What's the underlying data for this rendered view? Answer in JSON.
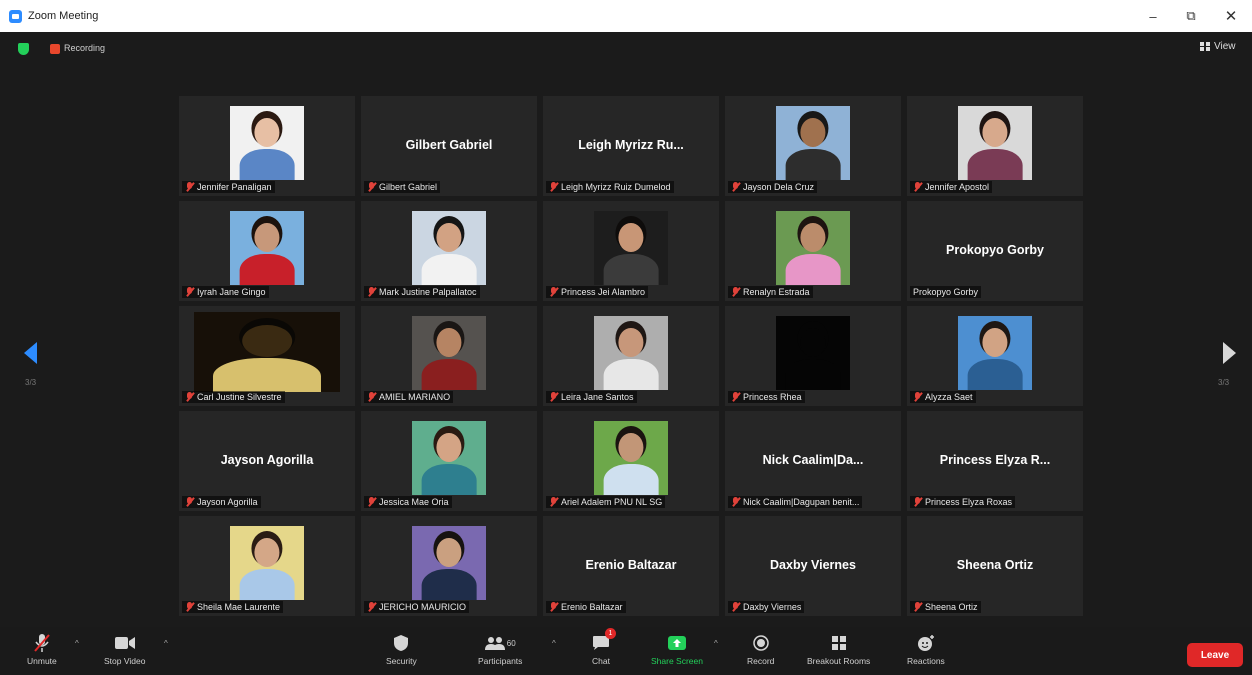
{
  "window": {
    "title": "Zoom Meeting",
    "minimize": "–",
    "maximize": "⧉",
    "close": "✕"
  },
  "meeting": {
    "recording_label": "Recording",
    "view_label": "View",
    "page_left": "3/3",
    "page_right": "3/3"
  },
  "participants": [
    {
      "name": "Jennifer Panaligan",
      "big": "",
      "video": true,
      "photo": {
        "bg": "#f1f1f1",
        "skin": "#e7bfa4",
        "hair": "#2b1a12",
        "shirt": "#5a86c6"
      }
    },
    {
      "name": "Gilbert Gabriel",
      "big": "Gilbert Gabriel",
      "video": false
    },
    {
      "name": "Leigh Myrizz Ruiz Dumelod",
      "big": "Leigh Myrizz Ru...",
      "video": false
    },
    {
      "name": "Jayson Dela Cruz",
      "big": "",
      "video": true,
      "photo": {
        "bg": "#8fb2d6",
        "skin": "#a0714e",
        "hair": "#181818",
        "shirt": "#2d2d2d"
      }
    },
    {
      "name": "Jennifer Apostol",
      "big": "",
      "video": true,
      "photo": {
        "bg": "#d9d9d9",
        "skin": "#d7a98c",
        "hair": "#1e1412",
        "shirt": "#7a3b55"
      }
    },
    {
      "name": "Iyrah Jane Gingo",
      "big": "",
      "video": true,
      "photo": {
        "bg": "#7ab0de",
        "skin": "#c7987a",
        "hair": "#1c120d",
        "shirt": "#c8202a"
      }
    },
    {
      "name": "Mark Justine Palpallatoc",
      "big": "",
      "video": true,
      "photo": {
        "bg": "#cbd6e2",
        "skin": "#d2a283",
        "hair": "#151515",
        "shirt": "#f2f2f2"
      }
    },
    {
      "name": "Princess Jei Alambro",
      "big": "",
      "video": true,
      "photo": {
        "bg": "#1d1d1d",
        "skin": "#c89676",
        "hair": "#0e0c0b",
        "shirt": "#3b3b3b"
      }
    },
    {
      "name": "Renalyn Estrada",
      "big": "",
      "video": true,
      "photo": {
        "bg": "#6b9a52",
        "skin": "#bb8c6b",
        "hair": "#1d1410",
        "shirt": "#e796c7"
      }
    },
    {
      "name": "Prokopyo Gorby",
      "big": "Prokopyo Gorby",
      "video": false,
      "no_mic": true
    },
    {
      "name": "Carl Justine Silvestre",
      "big": "",
      "video": true,
      "photo": {
        "bg": "#171008",
        "skin": "#3a2a12",
        "hair": "#0a0805",
        "shirt": "#d7c06d"
      },
      "wide": true
    },
    {
      "name": "AMIEL MARIANO",
      "big": "",
      "video": true,
      "photo": {
        "bg": "#55524f",
        "skin": "#b68463",
        "hair": "#1a1614",
        "shirt": "#8a1f1f"
      }
    },
    {
      "name": "Leira Jane Santos",
      "big": "",
      "video": true,
      "photo": {
        "bg": "#aeaeae",
        "skin": "#c7977a",
        "hair": "#1f1714",
        "shirt": "#e7e7e7"
      }
    },
    {
      "name": "Princess Rhea",
      "big": "",
      "video": true,
      "photo": {
        "bg": "#050505",
        "skin": "#050505",
        "hair": "#050505",
        "shirt": "#050505"
      }
    },
    {
      "name": "Alyzza Saet",
      "big": "",
      "video": true,
      "photo": {
        "bg": "#4d8fd1",
        "skin": "#d1a384",
        "hair": "#1e1713",
        "shirt": "#2b5f93"
      }
    },
    {
      "name": "Jayson Agorilla",
      "big": "Jayson Agorilla",
      "video": false
    },
    {
      "name": "Jessica Mae Oria",
      "big": "",
      "video": true,
      "photo": {
        "bg": "#5fae8e",
        "skin": "#d4a485",
        "hair": "#2a1a12",
        "shirt": "#2e7f8f"
      }
    },
    {
      "name": "Ariel Adalem PNU NL SG",
      "big": "",
      "video": true,
      "photo": {
        "bg": "#6da84a",
        "skin": "#c29677",
        "hair": "#1a1410",
        "shirt": "#cfe0ef"
      }
    },
    {
      "name": "Nick Caalim|Dagupan benit...",
      "big": "Nick Caalim|Da...",
      "video": false
    },
    {
      "name": "Princess Elyza Roxas",
      "big": "Princess Elyza R...",
      "video": false
    },
    {
      "name": "Sheila Mae Laurente",
      "big": "",
      "video": true,
      "photo": {
        "bg": "#e5d78a",
        "skin": "#d4a787",
        "hair": "#2a1c14",
        "shirt": "#a9c8e8"
      }
    },
    {
      "name": "JERICHO MAURICIO",
      "big": "",
      "video": true,
      "photo": {
        "bg": "#7a69b0",
        "skin": "#caa080",
        "hair": "#171310",
        "shirt": "#1f2d4a"
      }
    },
    {
      "name": "Erenio Baltazar",
      "big": "Erenio Baltazar",
      "video": false
    },
    {
      "name": "Daxby Viernes",
      "big": "Daxby Viernes",
      "video": false
    },
    {
      "name": "Sheena Ortiz",
      "big": "Sheena Ortiz",
      "video": false
    }
  ],
  "toolbar": {
    "unmute": "Unmute",
    "stop_video": "Stop Video",
    "security": "Security",
    "participants": "Participants",
    "participants_count": "60",
    "chat": "Chat",
    "chat_badge": "1",
    "share_screen": "Share Screen",
    "record": "Record",
    "breakout_rooms": "Breakout Rooms",
    "reactions": "Reactions",
    "leave": "Leave",
    "caret": "^"
  },
  "colors": {
    "share_green": "#23d05a",
    "leave_red": "#e02828",
    "accent_blue": "#2d8cff"
  }
}
